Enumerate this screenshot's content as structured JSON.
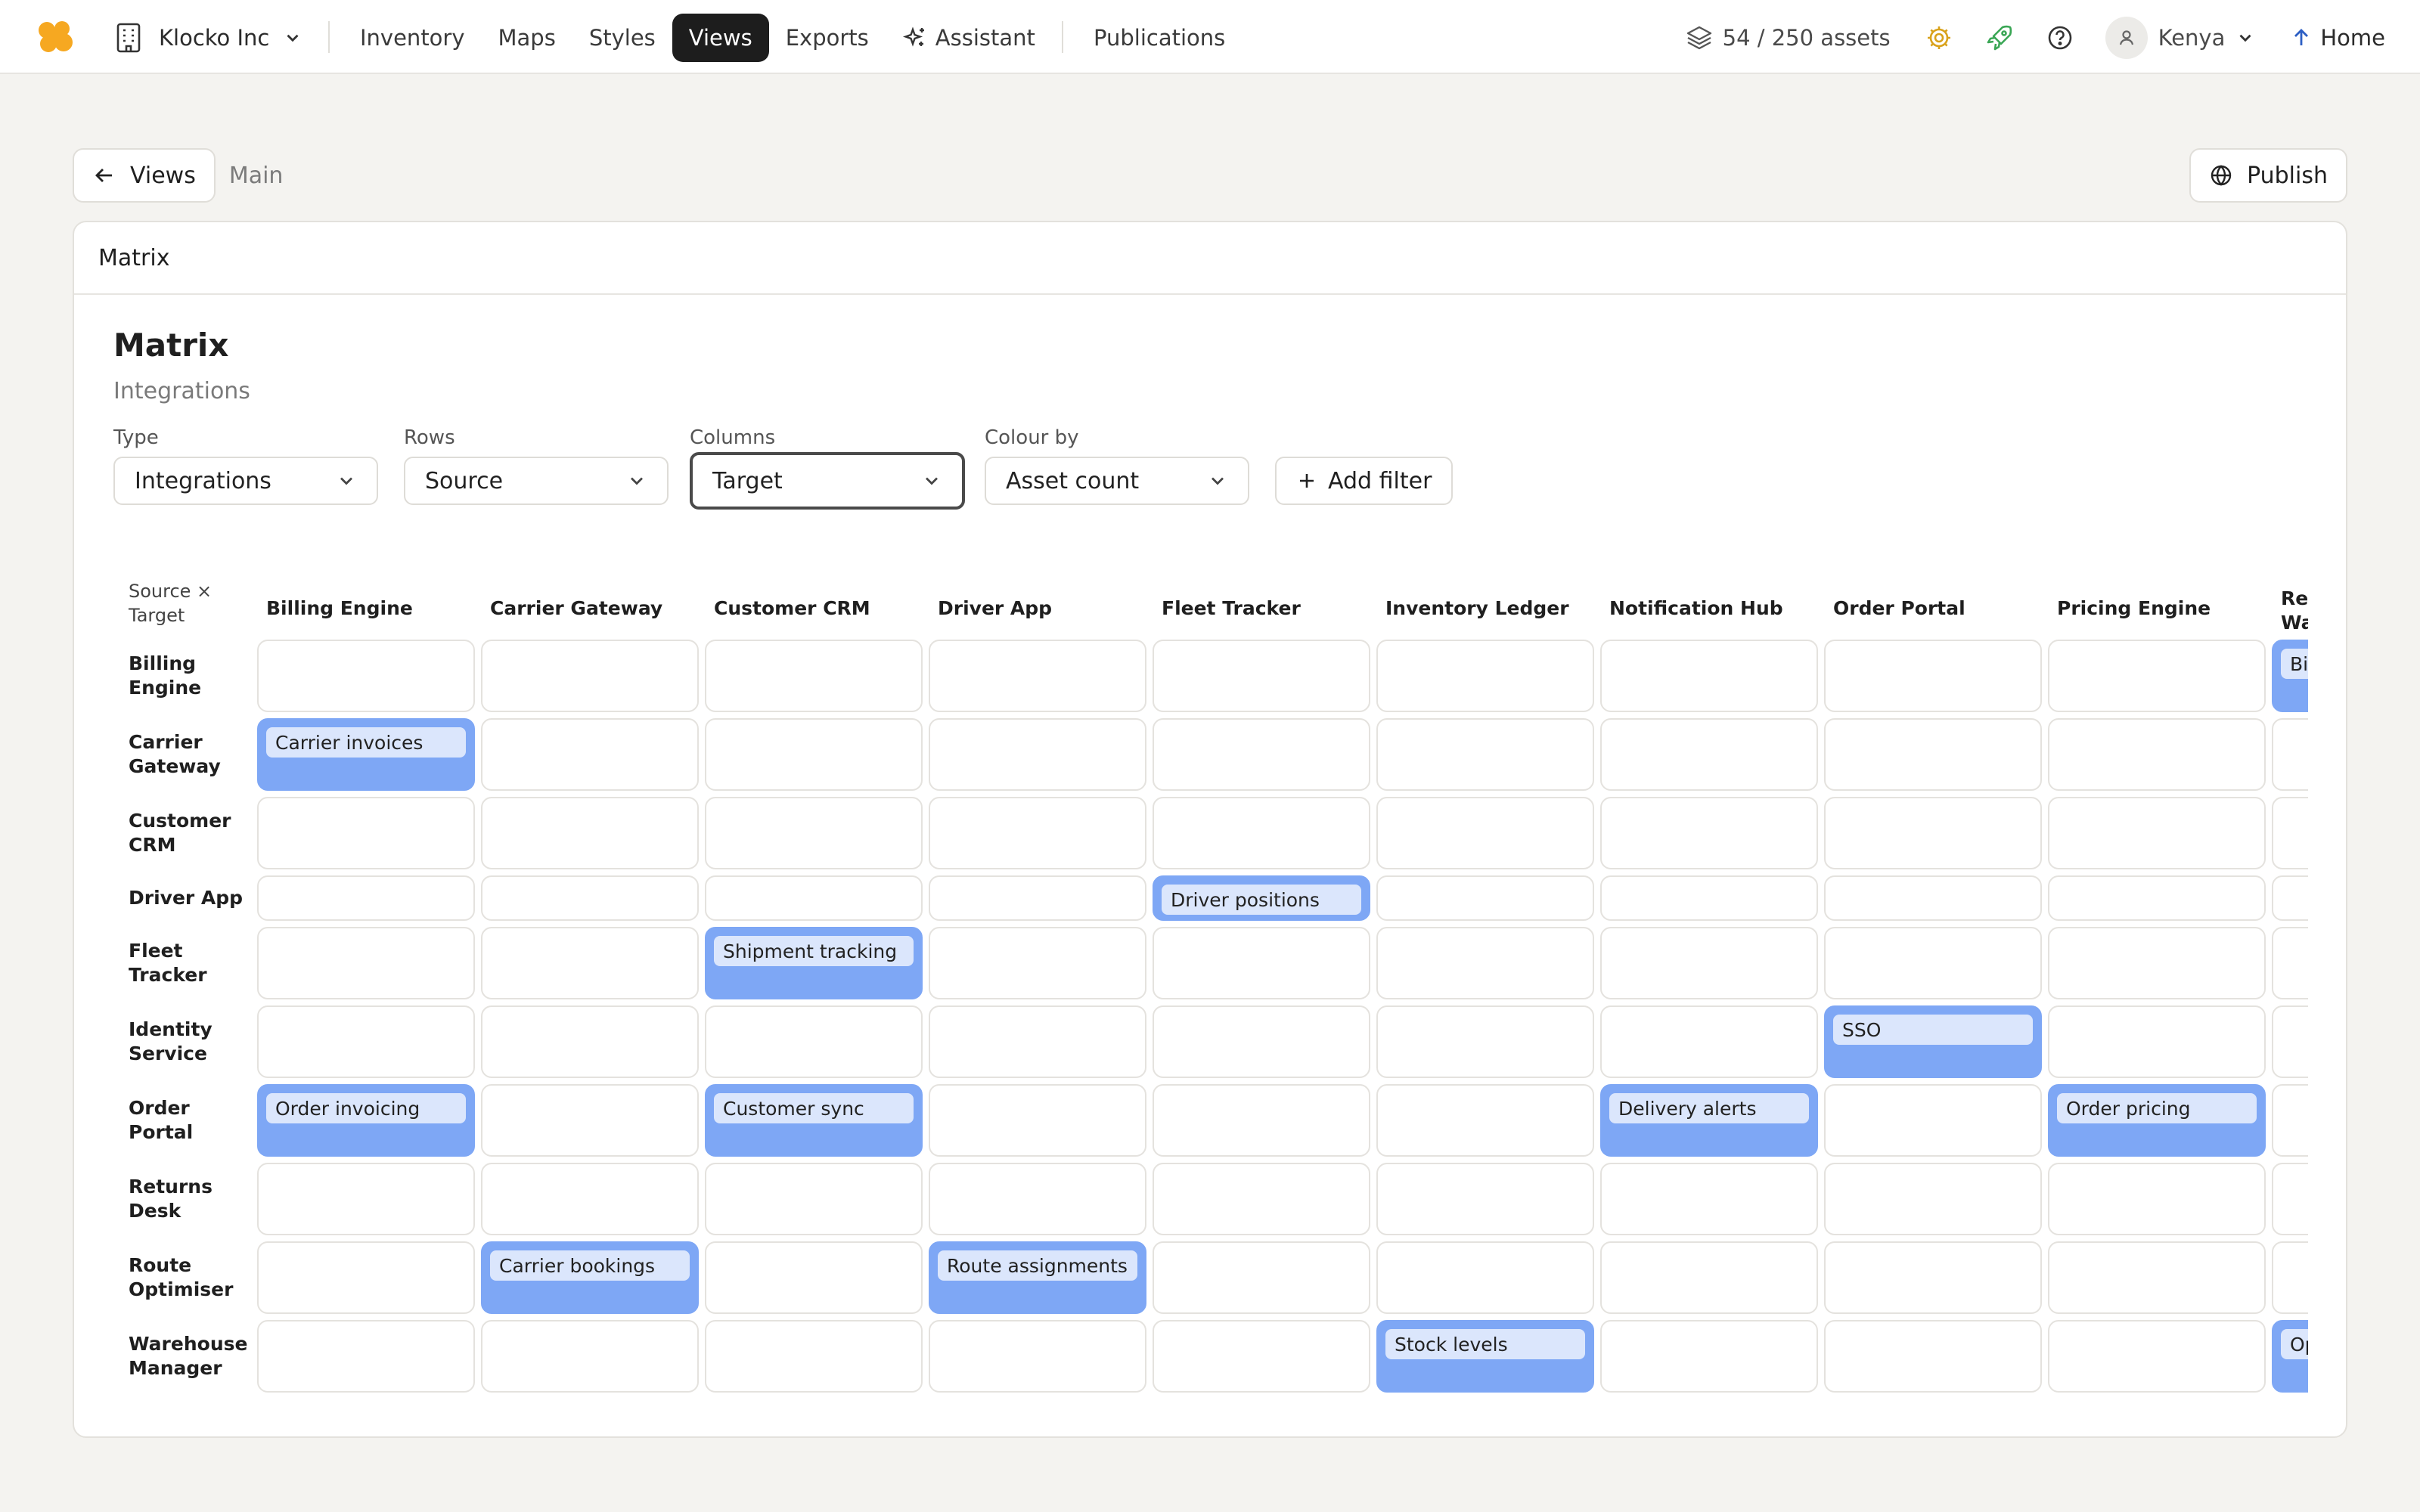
{
  "topbar": {
    "org": "Klocko Inc",
    "nav": [
      "Inventory",
      "Maps",
      "Styles",
      "Views",
      "Exports",
      "Assistant"
    ],
    "active_nav": "Views",
    "publications": "Publications",
    "assets": "54 / 250  assets",
    "user": "Kenya",
    "home": "Home",
    "icons": {
      "logo": "#f6a821",
      "gear": "#d9a21b",
      "rocket": "#3aa655",
      "home_arrow": "#2d5fc4"
    }
  },
  "breadcrumb": {
    "back_label": "Views",
    "current": "Main"
  },
  "publish_label": "Publish",
  "panel": {
    "tab": "Matrix",
    "title": "Matrix",
    "subtitle": "Integrations"
  },
  "filters": [
    {
      "label": "Type",
      "value": "Integrations"
    },
    {
      "label": "Rows",
      "value": "Source"
    },
    {
      "label": "Columns",
      "value": "Target"
    },
    {
      "label": "Colour by",
      "value": "Asset count"
    }
  ],
  "add_filter": "Add filter",
  "matrix": {
    "corner": [
      "Source ×",
      "Target"
    ],
    "columns": [
      "Billing Engine",
      "Carrier Gateway",
      "Customer CRM",
      "Driver App",
      "Fleet Tracker",
      "Inventory Ledger",
      "Notification Hub",
      "Order Portal",
      "Pricing Engine",
      "Re Wa"
    ],
    "rows": [
      {
        "label": [
          "Billing",
          "Engine"
        ],
        "cells": {
          "9": "Bi"
        }
      },
      {
        "label": [
          "Carrier",
          "Gateway"
        ],
        "cells": {
          "0": "Carrier invoices"
        }
      },
      {
        "label": [
          "Customer",
          "CRM"
        ],
        "cells": {}
      },
      {
        "label": [
          "Driver App"
        ],
        "cells": {
          "4": "Driver positions"
        }
      },
      {
        "label": [
          "Fleet",
          "Tracker"
        ],
        "cells": {
          "2": "Shipment tracking"
        }
      },
      {
        "label": [
          "Identity",
          "Service"
        ],
        "cells": {
          "7": "SSO"
        }
      },
      {
        "label": [
          "Order",
          "Portal"
        ],
        "cells": {
          "0": "Order invoicing",
          "2": "Customer sync",
          "6": "Delivery alerts",
          "8": "Order pricing"
        }
      },
      {
        "label": [
          "Returns",
          "Desk"
        ],
        "cells": {}
      },
      {
        "label": [
          "Route",
          "Optimiser"
        ],
        "cells": {
          "1": "Carrier bookings",
          "3": "Route assignments"
        }
      },
      {
        "label": [
          "Warehouse",
          "Manager"
        ],
        "cells": {
          "5": "Stock levels",
          "9": "Op"
        }
      }
    ]
  }
}
